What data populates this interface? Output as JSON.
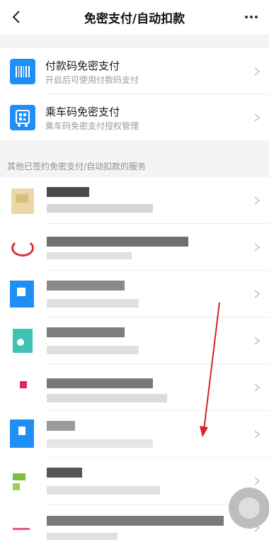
{
  "header": {
    "title": "免密支付/自动扣款",
    "back_icon": "chevron-left-icon",
    "more_icon": "more-dots-icon"
  },
  "primary_services": [
    {
      "title": "付款码免密支付",
      "subtitle": "开启后可使用付款码支付",
      "icon": "barcode-icon",
      "icon_color": "#1f8ff5"
    },
    {
      "title": "乘车码免密支付",
      "subtitle": "乘车码免密支付授权管理",
      "icon": "bus-qrcode-icon",
      "icon_color": "#1f8ff5"
    }
  ],
  "section_label": "其他已签约免密支付/自动扣款的服务",
  "colors": {
    "accent": "#1f8ff5",
    "annotation_arrow": "#d42424",
    "page_bg": "#f4f4f4"
  }
}
